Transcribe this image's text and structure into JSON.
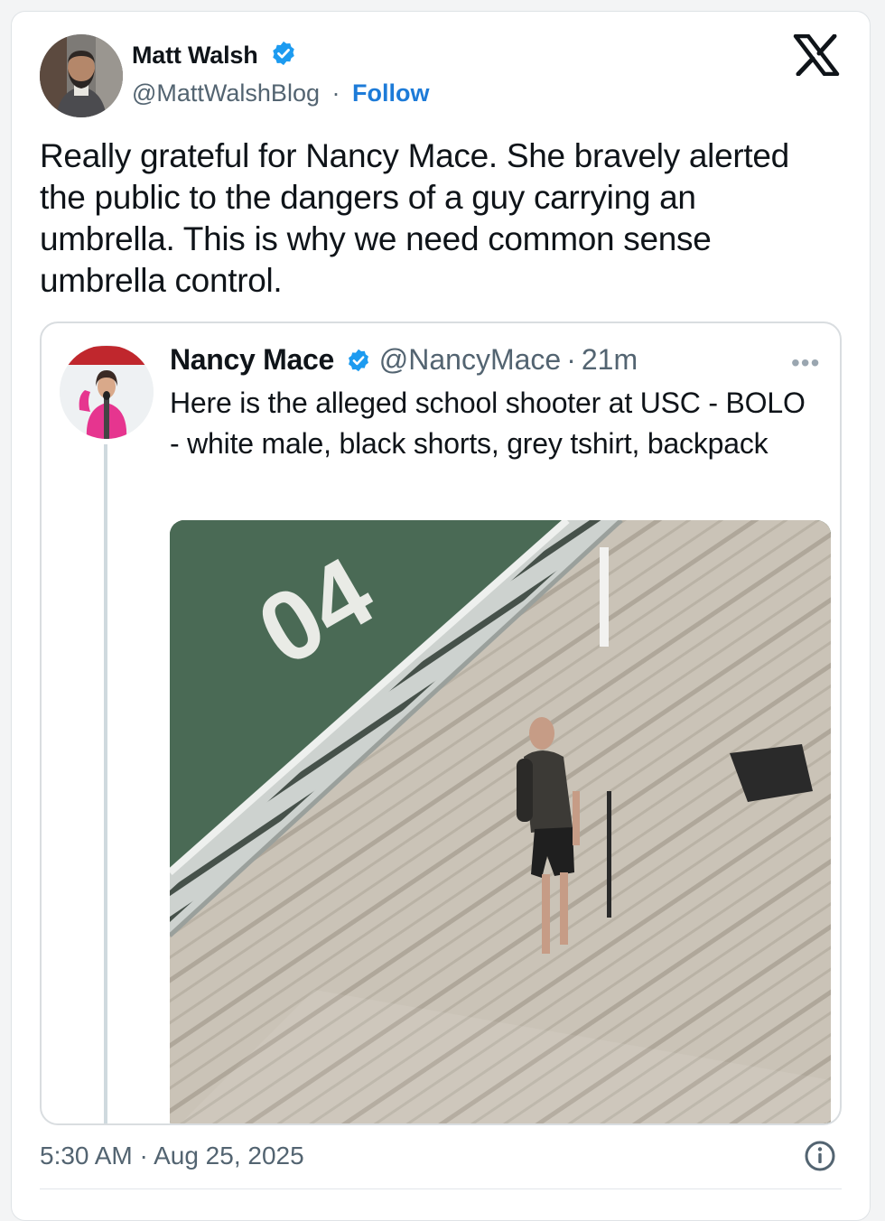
{
  "author": {
    "name": "Matt Walsh",
    "handle": "@MattWalshBlog",
    "separator": "·",
    "follow_label": "Follow",
    "verified": true
  },
  "tweet": {
    "text": "Really grateful for Nancy Mace. She bravely alerted the public to the dangers of a guy carrying an umbrella. This is why we need common sense umbrella control."
  },
  "quoted": {
    "name": "Nancy Mace",
    "handle": "@NancyMace",
    "separator": "·",
    "time": "21m",
    "more_label": "•••",
    "text": "Here is the alleged school shooter at USC - BOLO - white male, black shorts, grey tshirt, backpack"
  },
  "footer": {
    "timestamp": "5:30 AM · Aug 25, 2025"
  },
  "icons": {
    "verified": "verified-badge-icon",
    "brand": "x-logo-icon",
    "info": "info-icon"
  },
  "colors": {
    "link": "#1d7bd8",
    "verified": "#1d9bf0",
    "text": "#0f1419",
    "muted": "#536471"
  }
}
